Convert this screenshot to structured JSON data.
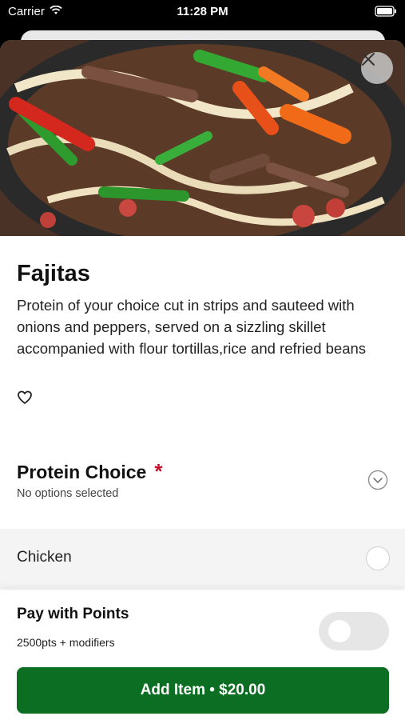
{
  "status_bar": {
    "carrier": "Carrier",
    "time": "11:28 PM"
  },
  "item": {
    "title": "Fajitas",
    "description": "Protein of your choice cut in strips and sauteed with onions and peppers, served on a sizzling skillet accompanied with flour tortillas,rice and refried beans"
  },
  "modifier_group": {
    "title": "Protein Choice",
    "required_marker": "*",
    "subtitle": "No options selected",
    "options": [
      {
        "label": "Chicken",
        "selected": false
      }
    ]
  },
  "points": {
    "title": "Pay with Points",
    "subtitle": "2500pts + modifiers",
    "enabled": false
  },
  "cta": {
    "label": "Add Item • $20.00"
  },
  "colors": {
    "primary": "#0b6e22",
    "required": "#c8102e",
    "option_bg": "#f4f4f4"
  },
  "icons": [
    "wifi-icon",
    "battery-icon",
    "close-icon",
    "heart-icon",
    "chevron-down-icon"
  ]
}
